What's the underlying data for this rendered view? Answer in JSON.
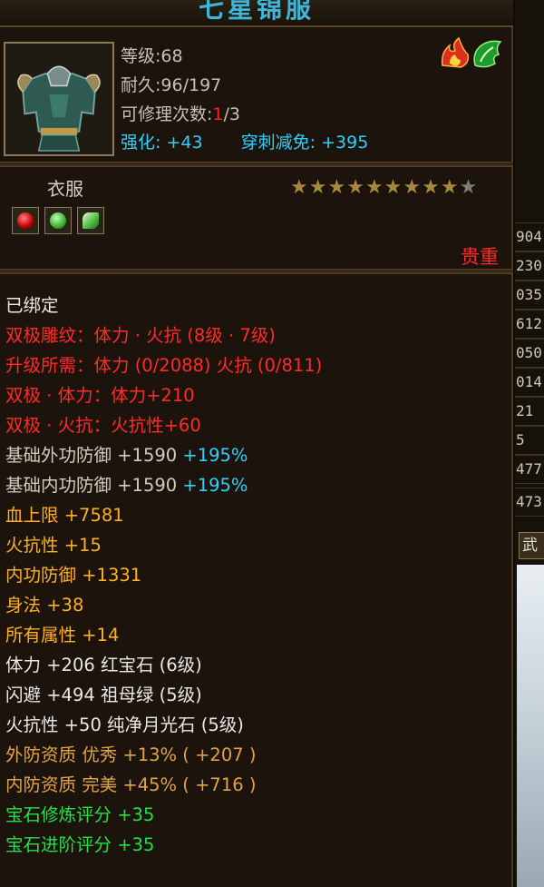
{
  "item": {
    "title": "七星锦服",
    "level_line": "等级:68",
    "durability_line": "耐久:96/197",
    "repair_label": "可修理次数:",
    "repair_used": "1",
    "repair_total": "/3",
    "enhance_label": "强化:",
    "enhance_value": "+43",
    "pierce_label": "穿刺减免:",
    "pierce_value": "+395",
    "slot_name": "衣服",
    "rarity": "贵重",
    "stars_filled": 9,
    "stars_total": 10
  },
  "properties": [
    {
      "text": "已绑定",
      "color": "white"
    },
    {
      "text": "双极雕纹：体力 · 火抗 (8级 · 7级)",
      "color": "red"
    },
    {
      "text": "升级所需：体力 (0/2088)  火抗 (0/811)",
      "color": "red"
    },
    {
      "text": "双极 · 体力：体力+210",
      "color": "red"
    },
    {
      "text": "双极 · 火抗：火抗性+60",
      "color": "red"
    }
  ],
  "base_stats": [
    {
      "label": "基础外功防御 +1590",
      "bonus": "+195%"
    },
    {
      "label": "基础内功防御 +1590",
      "bonus": "+195%"
    }
  ],
  "attributes": [
    {
      "text": "血上限 +7581",
      "color": "orange"
    },
    {
      "text": "火抗性 +15",
      "color": "orange"
    },
    {
      "text": "内功防御 +1331",
      "color": "orange"
    },
    {
      "text": "身法 +38",
      "color": "orange"
    },
    {
      "text": "所有属性 +14",
      "color": "orange"
    }
  ],
  "gems": [
    {
      "text": "体力 +206 红宝石 (6级)"
    },
    {
      "text": "闪避 +494 祖母绿 (5级)"
    },
    {
      "text": "火抗性 +50 纯净月光石 (5级)"
    }
  ],
  "qualities": [
    {
      "text": "外防资质  优秀 +13% ( +207 )"
    },
    {
      "text": "内防资质  完美 +45% ( +716 )"
    }
  ],
  "scores": [
    {
      "text": "宝石修炼评分 +35"
    },
    {
      "text": "宝石进阶评分 +35"
    }
  ],
  "side_values": [
    "904",
    "230",
    "035",
    "612",
    "050",
    "014",
    "21",
    "5",
    "477",
    "473"
  ],
  "side_button": "武",
  "colors": {
    "title": "#3fb6d8",
    "cyan": "#2fd0ff",
    "red": "#ff2a2a",
    "orange": "#ffb020",
    "gold": "#e0a24a",
    "green": "#22e04a",
    "star": "#a8883c"
  }
}
